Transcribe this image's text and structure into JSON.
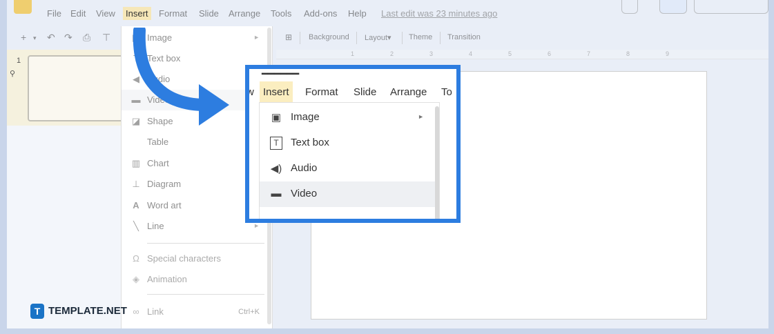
{
  "menubar": {
    "items": [
      "File",
      "Edit",
      "View",
      "Insert",
      "Format",
      "Slide",
      "Arrange",
      "Tools",
      "Add-ons",
      "Help"
    ],
    "active": "Insert",
    "last_edit": "Last edit was 23 minutes ago"
  },
  "toolbar": {
    "icons": [
      "plus-icon",
      "undo-icon",
      "redo-icon",
      "print-icon",
      "paint-format-icon"
    ],
    "buttons": [
      "Background",
      "Layout",
      "Theme",
      "Transition"
    ]
  },
  "ruler": {
    "marks": [
      "1",
      "2",
      "3",
      "4",
      "5",
      "6",
      "7",
      "8",
      "9"
    ]
  },
  "left_panel": {
    "slide_number": "1"
  },
  "insert_menu": {
    "items": [
      {
        "label": "Image",
        "icon": "image-icon",
        "submenu": true
      },
      {
        "label": "Text box",
        "icon": "text-box-icon"
      },
      {
        "label": "Audio",
        "icon": "audio-icon"
      },
      {
        "label": "Video",
        "icon": "video-icon"
      },
      {
        "label": "Shape",
        "icon": "shape-icon",
        "submenu": true
      },
      {
        "label": "Table",
        "icon": "table-icon",
        "submenu": true
      },
      {
        "label": "Chart",
        "icon": "chart-icon",
        "submenu": true
      },
      {
        "label": "Diagram",
        "icon": "diagram-icon"
      },
      {
        "label": "Word art",
        "icon": "word-art-icon"
      },
      {
        "label": "Line",
        "icon": "line-icon",
        "submenu": true
      },
      {
        "label": "Special characters",
        "icon": "omega-icon",
        "disabled": true
      },
      {
        "label": "Animation",
        "icon": "animation-icon",
        "disabled": true
      },
      {
        "label": "Link",
        "icon": "link-icon",
        "disabled": true,
        "shortcut": "Ctrl+K"
      }
    ]
  },
  "zoom": {
    "menu": [
      "w",
      "Insert",
      "Format",
      "Slide",
      "Arrange",
      "To"
    ],
    "items": [
      {
        "label": "Image",
        "icon": "image-icon",
        "submenu": true
      },
      {
        "label": "Text box",
        "icon": "text-box-icon"
      },
      {
        "label": "Audio",
        "icon": "audio-icon"
      },
      {
        "label": "Video",
        "icon": "video-icon",
        "hover": true
      }
    ],
    "highlight_color": "#2d7de0"
  },
  "brand": {
    "badge": "T",
    "name": "TEMPLATE.NET"
  }
}
